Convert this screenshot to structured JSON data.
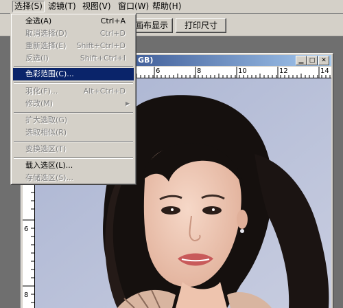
{
  "menubar": {
    "items": [
      {
        "label": "选择(S)"
      },
      {
        "label": "滤镜(T)"
      },
      {
        "label": "视图(V)"
      },
      {
        "label": "窗口(W)"
      },
      {
        "label": "帮助(H)"
      }
    ]
  },
  "options_bar": {
    "fit_screen_label": "画布显示",
    "print_size_label": "打印尺寸"
  },
  "document": {
    "title_suffix": "GB)",
    "ruler_h": [
      "6",
      "8",
      "10",
      "12",
      "14"
    ],
    "ruler_v": [
      "6",
      "8"
    ]
  },
  "select_menu": {
    "items": [
      {
        "label": "全选(A)",
        "shortcut": "Ctrl+A",
        "enabled": true
      },
      {
        "label": "取消选择(D)",
        "shortcut": "Ctrl+D",
        "enabled": false
      },
      {
        "label": "重新选择(E)",
        "shortcut": "Shift+Ctrl+D",
        "enabled": false
      },
      {
        "label": "反选(I)",
        "shortcut": "Shift+Ctrl+I",
        "enabled": false
      },
      {
        "label": "色彩范围(C)...",
        "shortcut": "",
        "enabled": true,
        "highlighted": true
      },
      {
        "label": "羽化(F)...",
        "shortcut": "Alt+Ctrl+D",
        "enabled": false
      },
      {
        "label": "修改(M)",
        "shortcut": "",
        "enabled": false,
        "submenu": true
      },
      {
        "label": "扩大选取(G)",
        "shortcut": "",
        "enabled": false
      },
      {
        "label": "选取相似(R)",
        "shortcut": "",
        "enabled": false
      },
      {
        "label": "变换选区(T)",
        "shortcut": "",
        "enabled": false
      },
      {
        "label": "载入选区(L)...",
        "shortcut": "",
        "enabled": true
      },
      {
        "label": "存储选区(S)...",
        "shortcut": "",
        "enabled": false
      }
    ]
  },
  "colors": {
    "menu_highlight": "#0a246a",
    "chrome": "#d4d0c8",
    "title_gradient_start": "#0a246a",
    "title_gradient_end": "#a6caf0"
  }
}
